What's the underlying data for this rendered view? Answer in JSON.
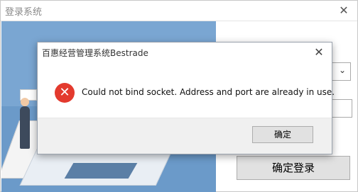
{
  "login_window": {
    "title": "登录系统",
    "close_glyph": "✕",
    "login_button_label": "确定登录",
    "combo_arrow_glyph": "⌄"
  },
  "dialog": {
    "title": "百惠经营管理系统Bestrade",
    "message": "Could not bind socket. Address and port are already in use.",
    "ok_label": "确定",
    "close_glyph": "✕",
    "error_icon_glyph": "✕",
    "error_icon_name": "error-icon"
  },
  "colors": {
    "error_red": "#e33a2e",
    "illustration_blue": "#7aa6d2",
    "button_gray": "#e1e1e1"
  }
}
